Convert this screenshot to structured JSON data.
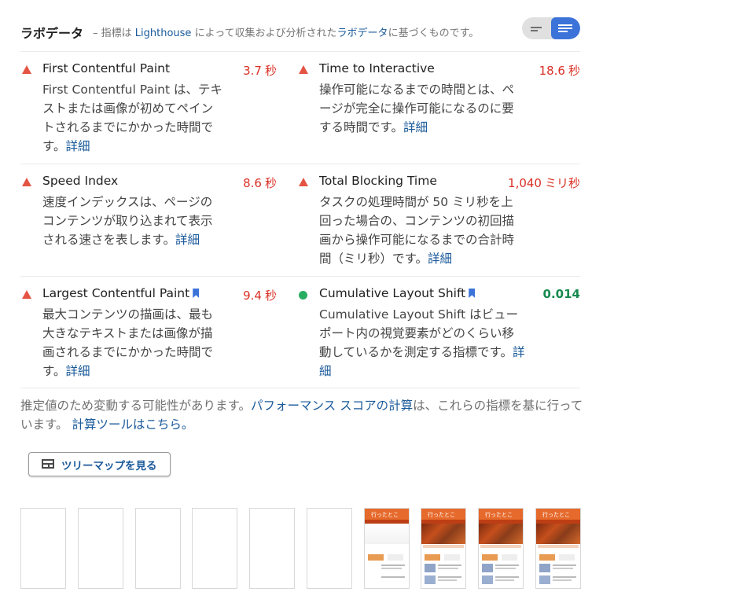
{
  "header": {
    "title": "ラボデータ",
    "desc_prefix": "– 指標は",
    "desc_link": "Lighthouse",
    "desc_middle": "によって収集および分析された",
    "desc_link2": "ラボデータ",
    "desc_suffix": "に基づくものです。"
  },
  "view_toggle": {
    "selected": "list"
  },
  "metrics": [
    {
      "name": "First Contentful Paint",
      "value": "3.7",
      "unit": "秒",
      "status": "fail",
      "desc": "First Contentful Paint は、テキストまたは画像が初めてペイントされるまでにかかった時間です。",
      "link": "詳細"
    },
    {
      "name": "Time to Interactive",
      "value": "18.6",
      "unit": "秒",
      "status": "fail",
      "desc": "操作可能になるまでの時間とは、ページが完全に操作可能になるのに要する時間です。",
      "link": "詳細"
    },
    {
      "name": "Speed Index",
      "value": "8.6",
      "unit": "秒",
      "status": "fail",
      "desc": "速度インデックスは、ページのコンテンツが取り込まれて表示される速さを表します。",
      "link": "詳細"
    },
    {
      "name": "Total Blocking Time",
      "value": "1,040",
      "unit": "ミリ秒",
      "status": "fail",
      "desc": "タスクの処理時間が 50 ミリ秒を上回った場合の、コンテンツの初回描画から操作可能になるまでの合計時間（ミリ秒）です。",
      "link": "詳細"
    },
    {
      "name": "Largest Contentful Paint",
      "value": "9.4",
      "unit": "秒",
      "status": "fail",
      "desc": "最大コンテンツの描画は、最も大きなテキストまたは画像が描画されるまでにかかった時間です。",
      "link": "詳細"
    },
    {
      "name": "Cumulative Layout Shift",
      "value": "0.014",
      "unit": "",
      "status": "pass",
      "desc": "Cumulative Layout Shift はビューポート内の視覚要素がどのくらい移動しているかを測定する指標です。",
      "link": "詳細"
    }
  ],
  "note": {
    "prefix": "推定値のため変動する可能性があります。",
    "link1": "パフォーマンス スコアの計算",
    "middle": "は、これらの指標を基に行っています。",
    "link2": "計算ツールはこちら。"
  },
  "treemap_button": {
    "label": "ツリーマップを見る"
  },
  "filmstrip": {
    "thumbnail_title": "行ったところ。"
  },
  "colors": {
    "fail": "#e45444",
    "pass": "#27ae60",
    "link": "#1a5a9a",
    "toggle_active": "#3b73d9"
  }
}
